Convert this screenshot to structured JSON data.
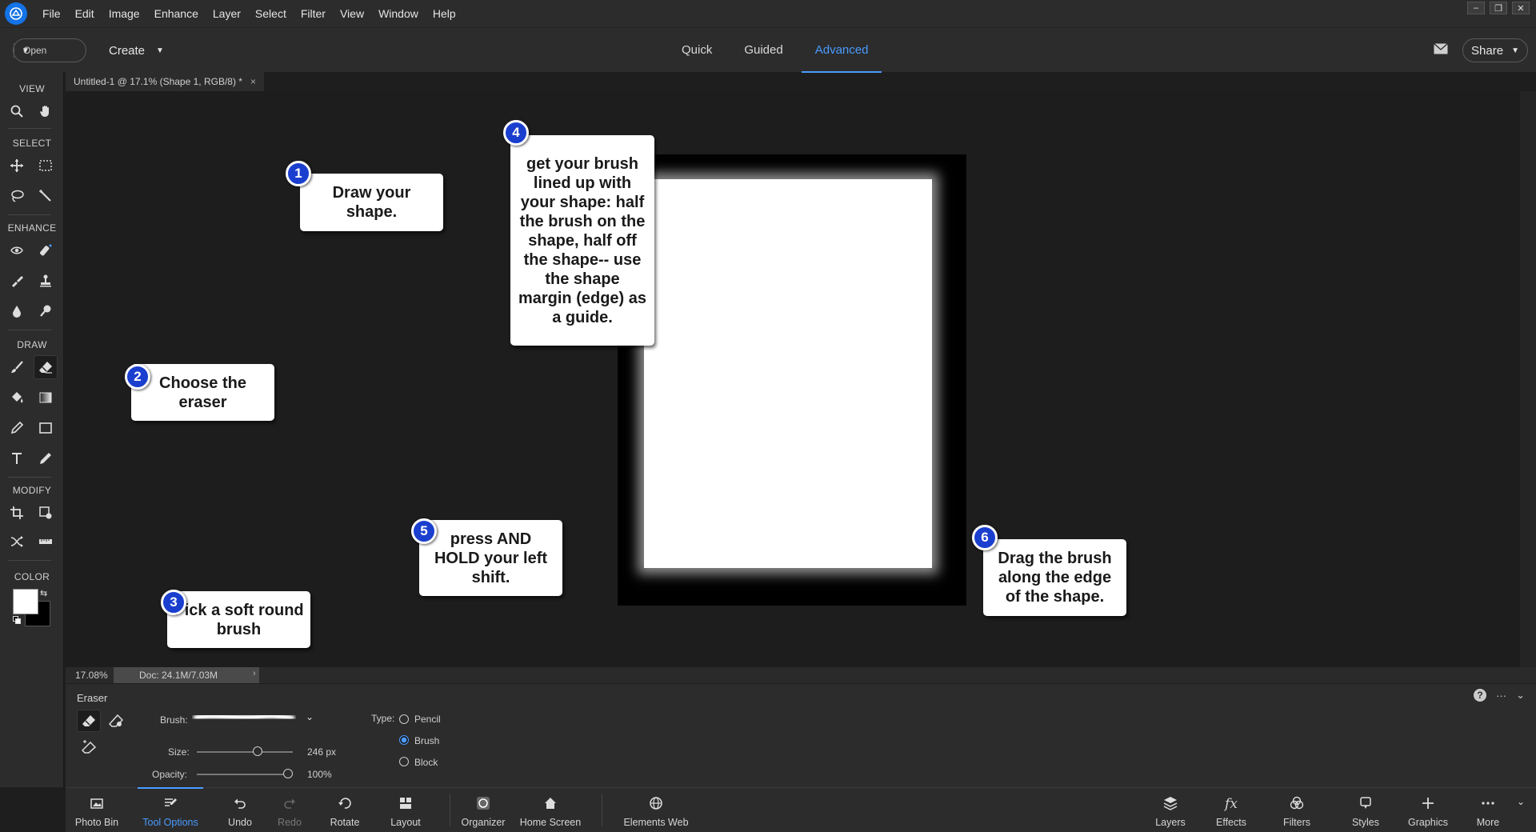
{
  "menubar": {
    "items": [
      "File",
      "Edit",
      "Image",
      "Enhance",
      "Layer",
      "Select",
      "Filter",
      "View",
      "Window",
      "Help"
    ],
    "window_controls": [
      "–",
      "❐",
      "✕"
    ]
  },
  "modebar": {
    "open_label": "Open",
    "create_label": "Create",
    "modes": [
      "Quick",
      "Guided",
      "Advanced"
    ],
    "active_mode": "Advanced",
    "share_label": "Share"
  },
  "toolbar": {
    "sections": [
      "VIEW",
      "SELECT",
      "ENHANCE",
      "DRAW",
      "MODIFY",
      "COLOR"
    ],
    "active_tool": "eraser",
    "foreground_color": "#ffffff",
    "background_color": "#000000"
  },
  "document": {
    "tab_title": "Untitled-1 @ 17.1% (Shape 1, RGB/8) *",
    "close_glyph": "×",
    "zoom_readout": "17.08%",
    "doc_info": "Doc: 24.1M/7.03M",
    "doc_arrow": "›"
  },
  "callouts": [
    {
      "number": "1",
      "text": "Draw your shape."
    },
    {
      "number": "2",
      "text": "Choose the eraser"
    },
    {
      "number": "3",
      "text": "Pick a soft round brush"
    },
    {
      "number": "4",
      "text": "get your brush lined up with your shape:  half the brush on the shape, half off the shape-- use the shape margin (edge) as a guide."
    },
    {
      "number": "5",
      "text": "press AND HOLD your left shift."
    },
    {
      "number": "6",
      "text": "Drag the brush along the edge of the shape."
    }
  ],
  "tool_options": {
    "title": "Eraser",
    "help_glyph": "?",
    "more_glyph": "···",
    "collapse_glyph": "⌄",
    "brush_label": "Brush:",
    "size_label": "Size:",
    "size_value": "246 px",
    "size_slider_fraction": 0.63,
    "opacity_label": "Opacity:",
    "opacity_value": "100%",
    "opacity_slider_fraction": 1.0,
    "type_label": "Type:",
    "type_options": [
      "Pencil",
      "Brush",
      "Block"
    ],
    "type_selected": "Brush"
  },
  "taskbar": {
    "left_items": [
      "Photo Bin",
      "Tool Options",
      "Undo",
      "Redo",
      "Rotate",
      "Layout",
      "Organizer",
      "Home Screen",
      "Elements Web"
    ],
    "right_items": [
      "Layers",
      "Effects",
      "Filters",
      "Styles",
      "Graphics",
      "More"
    ],
    "active_item": "Tool Options",
    "effects_glyph": "fx"
  },
  "colors": {
    "accent": "#4a9bff",
    "badge": "#1a3fcf"
  }
}
